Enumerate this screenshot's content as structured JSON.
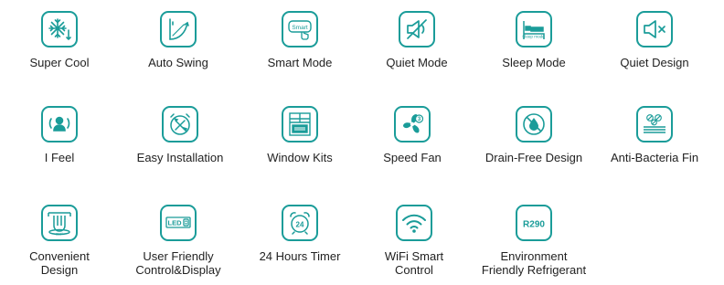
{
  "colors": {
    "accent": "#1a9c99",
    "text": "#222222"
  },
  "features": [
    {
      "label": "Super Cool",
      "icon": "snowflake-icon"
    },
    {
      "label": "Auto Swing",
      "icon": "swing-louver-icon"
    },
    {
      "label": "Smart Mode",
      "icon": "smart-mode-icon",
      "badge": "Smart"
    },
    {
      "label": "Quiet Mode",
      "icon": "muted-speaker-icon"
    },
    {
      "label": "Sleep Mode",
      "icon": "bed-icon",
      "badge": "Sleep mode"
    },
    {
      "label": "Quiet Design",
      "icon": "speaker-x-icon"
    },
    {
      "label": "I Feel",
      "icon": "i-feel-person-icon"
    },
    {
      "label": "Easy Installation",
      "icon": "wrench-screwdriver-icon"
    },
    {
      "label": "Window Kits",
      "icon": "window-kit-icon"
    },
    {
      "label": "Speed Fan",
      "icon": "fan-icon",
      "badge": "3"
    },
    {
      "label": "Drain-Free Design",
      "icon": "water-drop-icon"
    },
    {
      "label": "Anti-Bacteria Fin",
      "icon": "anti-bacteria-icon"
    },
    {
      "label": "Convenient\nDesign",
      "icon": "rotation-360-icon",
      "badge": "360°"
    },
    {
      "label": "User Friendly\nControl&Display",
      "icon": "led-display-icon",
      "badge": "LED"
    },
    {
      "label": "24 Hours Timer",
      "icon": "alarm-clock-icon",
      "badge": "24"
    },
    {
      "label": "WiFi Smart\nControl",
      "icon": "wifi-icon"
    },
    {
      "label": "Environment\nFriendly Refrigerant",
      "icon": "refrigerant-icon",
      "badge": "R290"
    }
  ]
}
